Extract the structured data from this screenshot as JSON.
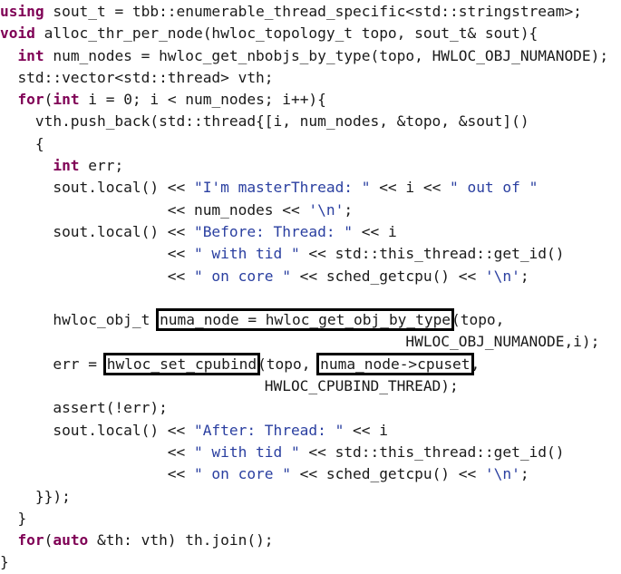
{
  "code": {
    "language": "C++",
    "lines": [
      [
        {
          "t": "kw",
          "v": "using"
        },
        {
          "t": "p",
          "v": " sout_t = tbb::enumerable_thread_specific<std::stringstream>;"
        }
      ],
      [
        {
          "t": "kw",
          "v": "void"
        },
        {
          "t": "p",
          "v": " alloc_thr_per_node(hwloc_topology_t topo, sout_t& sout){"
        }
      ],
      [
        {
          "t": "p",
          "v": "  "
        },
        {
          "t": "kw",
          "v": "int"
        },
        {
          "t": "p",
          "v": " num_nodes = hwloc_get_nbobjs_by_type(topo, HWLOC_OBJ_NUMANODE);"
        }
      ],
      [
        {
          "t": "p",
          "v": "  std::vector<std::thread> vth;"
        }
      ],
      [
        {
          "t": "p",
          "v": "  "
        },
        {
          "t": "kw",
          "v": "for"
        },
        {
          "t": "p",
          "v": "("
        },
        {
          "t": "kw",
          "v": "int"
        },
        {
          "t": "p",
          "v": " i = 0; i < num_nodes; i++){"
        }
      ],
      [
        {
          "t": "p",
          "v": "    vth.push_back(std::thread{[i, num_nodes, &topo, &sout]()"
        }
      ],
      [
        {
          "t": "p",
          "v": "    {"
        }
      ],
      [
        {
          "t": "p",
          "v": "      "
        },
        {
          "t": "kw",
          "v": "int"
        },
        {
          "t": "p",
          "v": " err;"
        }
      ],
      [
        {
          "t": "p",
          "v": "      sout.local() << "
        },
        {
          "t": "str",
          "v": "\"I'm masterThread: \""
        },
        {
          "t": "p",
          "v": " << i << "
        },
        {
          "t": "str",
          "v": "\" out of \""
        }
      ],
      [
        {
          "t": "p",
          "v": "                   << num_nodes << "
        },
        {
          "t": "str",
          "v": "'\\n'"
        },
        {
          "t": "p",
          "v": ";"
        }
      ],
      [
        {
          "t": "p",
          "v": "      sout.local() << "
        },
        {
          "t": "str",
          "v": "\"Before: Thread: \""
        },
        {
          "t": "p",
          "v": " << i"
        }
      ],
      [
        {
          "t": "p",
          "v": "                   << "
        },
        {
          "t": "str",
          "v": "\" with tid \""
        },
        {
          "t": "p",
          "v": " << std::this_thread::get_id()"
        }
      ],
      [
        {
          "t": "p",
          "v": "                   << "
        },
        {
          "t": "str",
          "v": "\" on core \""
        },
        {
          "t": "p",
          "v": " << sched_getcpu() << "
        },
        {
          "t": "str",
          "v": "'\\n'"
        },
        {
          "t": "p",
          "v": ";"
        }
      ],
      [
        {
          "t": "p",
          "v": ""
        }
      ],
      [
        {
          "t": "p",
          "v": "      hwloc_obj_t "
        },
        {
          "t": "box",
          "v": "numa_node = hwloc_get_obj_by_type"
        },
        {
          "t": "p",
          "v": "(topo,"
        }
      ],
      [
        {
          "t": "p",
          "v": "                                              HWLOC_OBJ_NUMANODE,i);"
        }
      ],
      [
        {
          "t": "p",
          "v": "      err = "
        },
        {
          "t": "box",
          "v": "hwloc_set_cpubind"
        },
        {
          "t": "p",
          "v": "(topo, "
        },
        {
          "t": "box",
          "v": "numa_node->cpuset"
        },
        {
          "t": "p",
          "v": ","
        }
      ],
      [
        {
          "t": "p",
          "v": "                              HWLOC_CPUBIND_THREAD);"
        }
      ],
      [
        {
          "t": "p",
          "v": "      assert(!err);"
        }
      ],
      [
        {
          "t": "p",
          "v": "      sout.local() << "
        },
        {
          "t": "str",
          "v": "\"After: Thread: \""
        },
        {
          "t": "p",
          "v": " << i"
        }
      ],
      [
        {
          "t": "p",
          "v": "                   << "
        },
        {
          "t": "str",
          "v": "\" with tid \""
        },
        {
          "t": "p",
          "v": " << std::this_thread::get_id()"
        }
      ],
      [
        {
          "t": "p",
          "v": "                   << "
        },
        {
          "t": "str",
          "v": "\" on core \""
        },
        {
          "t": "p",
          "v": " << sched_getcpu() << "
        },
        {
          "t": "str",
          "v": "'\\n'"
        },
        {
          "t": "p",
          "v": ";"
        }
      ],
      [
        {
          "t": "p",
          "v": "    }});"
        }
      ],
      [
        {
          "t": "p",
          "v": "  }"
        }
      ],
      [
        {
          "t": "p",
          "v": "  "
        },
        {
          "t": "kw",
          "v": "for"
        },
        {
          "t": "p",
          "v": "("
        },
        {
          "t": "kw",
          "v": "auto"
        },
        {
          "t": "p",
          "v": " &th: vth) th.join();"
        }
      ],
      [
        {
          "t": "p",
          "v": "}"
        }
      ]
    ]
  },
  "colors": {
    "keyword": "#7f0055",
    "string": "#2a3fa0",
    "plain": "#1a1a1a",
    "highlight_box": "#000000"
  }
}
